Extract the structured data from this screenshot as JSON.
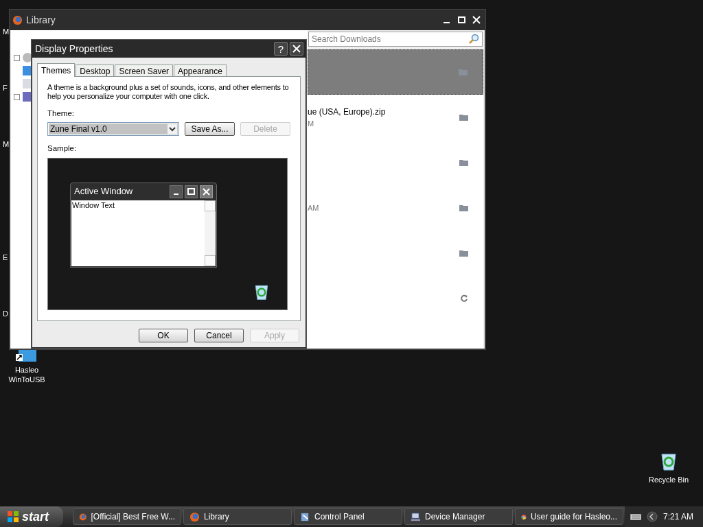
{
  "desktop_edge_labels": [
    "M",
    "F",
    "M",
    "E",
    "D"
  ],
  "desktop_icons": [
    {
      "label": "Hasleo\nWinToUSB",
      "kind": "shortcut"
    },
    {
      "label": "Recycle Bin",
      "kind": "bin"
    }
  ],
  "library": {
    "title": "Library",
    "search": {
      "placeholder": "Search Downloads"
    },
    "downloads": [
      {
        "selected": true,
        "kind": "folder"
      },
      {
        "name": "ue (USA, Europe).zip",
        "detail": "M",
        "selected": false,
        "kind": "folder"
      },
      {
        "selected": false,
        "kind": "folder"
      },
      {
        "detail": "AM",
        "selected": false,
        "kind": "folder"
      },
      {
        "selected": false,
        "kind": "folder"
      },
      {
        "selected": false,
        "kind": "retry"
      }
    ]
  },
  "dialog": {
    "title": "Display Properties",
    "help": "?",
    "tabs": [
      {
        "label": "Themes",
        "selected": true
      },
      {
        "label": "Desktop",
        "selected": false
      },
      {
        "label": "Screen Saver",
        "selected": false
      },
      {
        "label": "Appearance",
        "selected": false
      }
    ],
    "description": "A theme is a background plus a set of sounds, icons, and other elements to help you personalize your computer with one click.",
    "theme_label": "Theme:",
    "theme_value": "Zune Final v1.0",
    "theme_buttons": [
      {
        "label": "Save As...",
        "disabled": false
      },
      {
        "label": "Delete",
        "disabled": true
      }
    ],
    "sample_label": "Sample:",
    "sample": {
      "window_title": "Active Window",
      "window_text": "Window Text"
    },
    "buttons": [
      {
        "label": "OK",
        "disabled": false
      },
      {
        "label": "Cancel",
        "disabled": false
      },
      {
        "label": "Apply",
        "disabled": true
      }
    ]
  },
  "taskbar": {
    "start": "start",
    "items": [
      {
        "label": "[Official] Best Free W...",
        "kind": "firefox"
      },
      {
        "label": "Library",
        "kind": "firefox"
      },
      {
        "label": "Control Panel",
        "kind": "panel"
      },
      {
        "label": "Device Manager",
        "kind": "computer"
      },
      {
        "label": "User guide for Hasleo...",
        "kind": "chrome"
      }
    ],
    "clock": "7:21 AM"
  }
}
